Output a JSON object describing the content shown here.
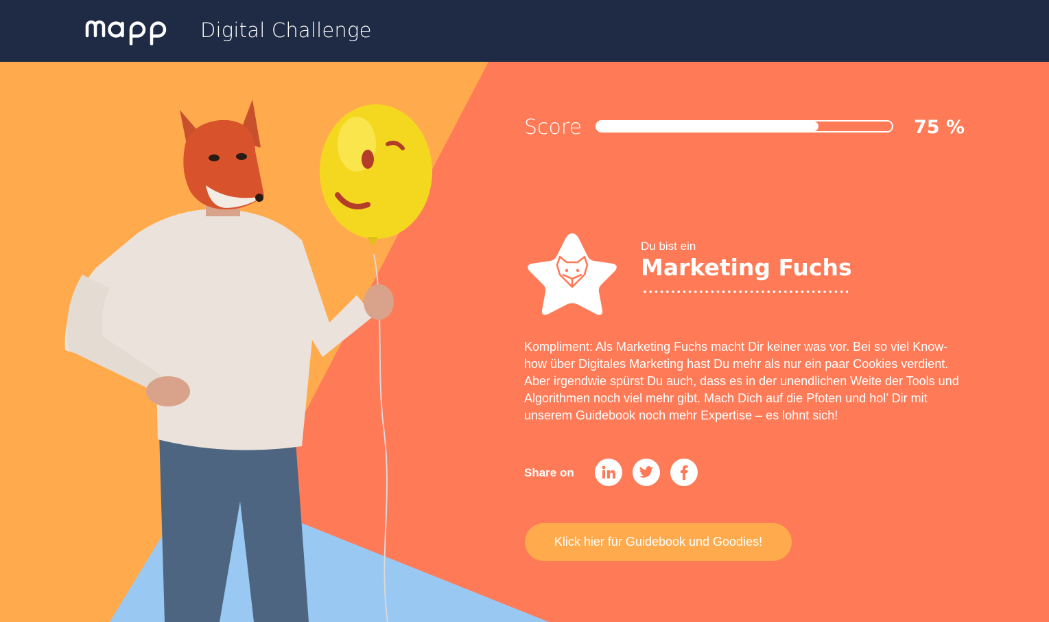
{
  "header": {
    "logo_text": "mapp",
    "title": "Digital Challenge"
  },
  "colors": {
    "header_bg": "#1f2a44",
    "orange_bg": "#ffab4d",
    "coral_bg": "#ff7a56",
    "blue_bg": "#99c8f3",
    "accent_coral": "#ff7a56"
  },
  "score": {
    "label": "Score",
    "value_text": "75 %",
    "fill_fraction": 0.75
  },
  "result": {
    "pre_title": "Du bist ein",
    "title": "Marketing Fuchs",
    "badge_icon": "fox-star-icon",
    "description": "Kompliment: Als Marketing Fuchs macht Dir keiner was vor. Bei so viel Know-how über Digitales Marketing hast Du mehr als nur ein paar Cookies verdient. Aber irgendwie spürst Du auch, dass es in der unendlichen Weite der Tools und Algorithmen noch viel mehr gibt. Mach Dich auf die Pfoten und hol’ Dir mit unserem Guidebook noch mehr Expertise – es lohnt sich!"
  },
  "share": {
    "label": "Share on",
    "networks": [
      "linkedin-icon",
      "twitter-icon",
      "facebook-icon"
    ]
  },
  "cta": {
    "label": "Klick hier für Guidebook und Goodies!"
  }
}
